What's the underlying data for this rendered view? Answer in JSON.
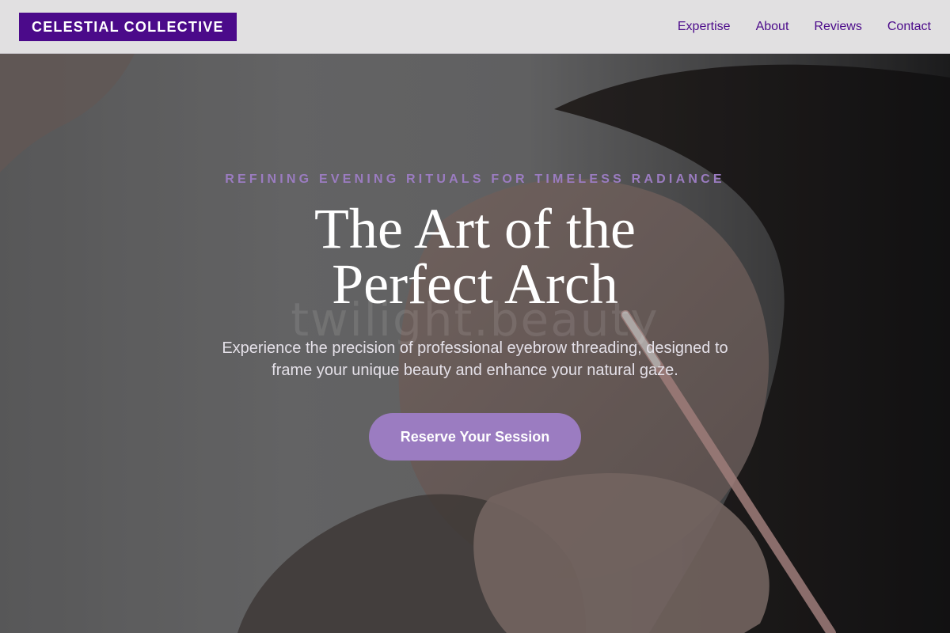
{
  "header": {
    "logo_text": "CELESTIAL COLLECTIVE",
    "nav": [
      {
        "label": "Expertise"
      },
      {
        "label": "About"
      },
      {
        "label": "Reviews"
      },
      {
        "label": "Contact"
      }
    ]
  },
  "hero": {
    "tagline": "REFINING EVENING RITUALS FOR TIMELESS RADIANCE",
    "title": "The Art of the Perfect Arch",
    "subtitle": "Experience the precision of professional eyebrow threading, designed to frame your unique beauty and enhance your natural gaze.",
    "watermark": "twilight.beauty",
    "cta_label": "Reserve Your Session"
  },
  "colors": {
    "brand": "#4b0a8a",
    "accent": "#9b7cc1",
    "header_bg": "#e1e0e1"
  }
}
